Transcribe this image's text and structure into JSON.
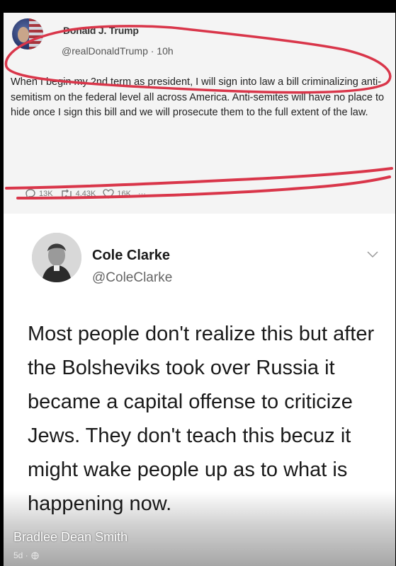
{
  "tweet1": {
    "name": "Donald J. Trump",
    "handle": "@realDonaldTrump · 10h",
    "text": "When I begin my 2nd term as president, I will sign into law a bill criminalizing anti-semitism on the federal level all across America. Anti-semites will have no place to hide once I sign this bill and we will prosecute them to the full extent of the law.",
    "replies": "13K",
    "retweets": "4.43K",
    "likes": "16K",
    "more": "···"
  },
  "tweet2": {
    "name": "Cole Clarke",
    "handle": "@ColeClarke",
    "text": "Most people don't realize this but after the Bolsheviks took over Russia it became a capital offense to criticize Jews. They don't teach this becuz it might wake people up as to what is happening now."
  },
  "post": {
    "author": "Bradlee Dean Smith",
    "age": "5d ·"
  },
  "colors": {
    "annotation_red": "#d9364a",
    "background": "#000000"
  }
}
